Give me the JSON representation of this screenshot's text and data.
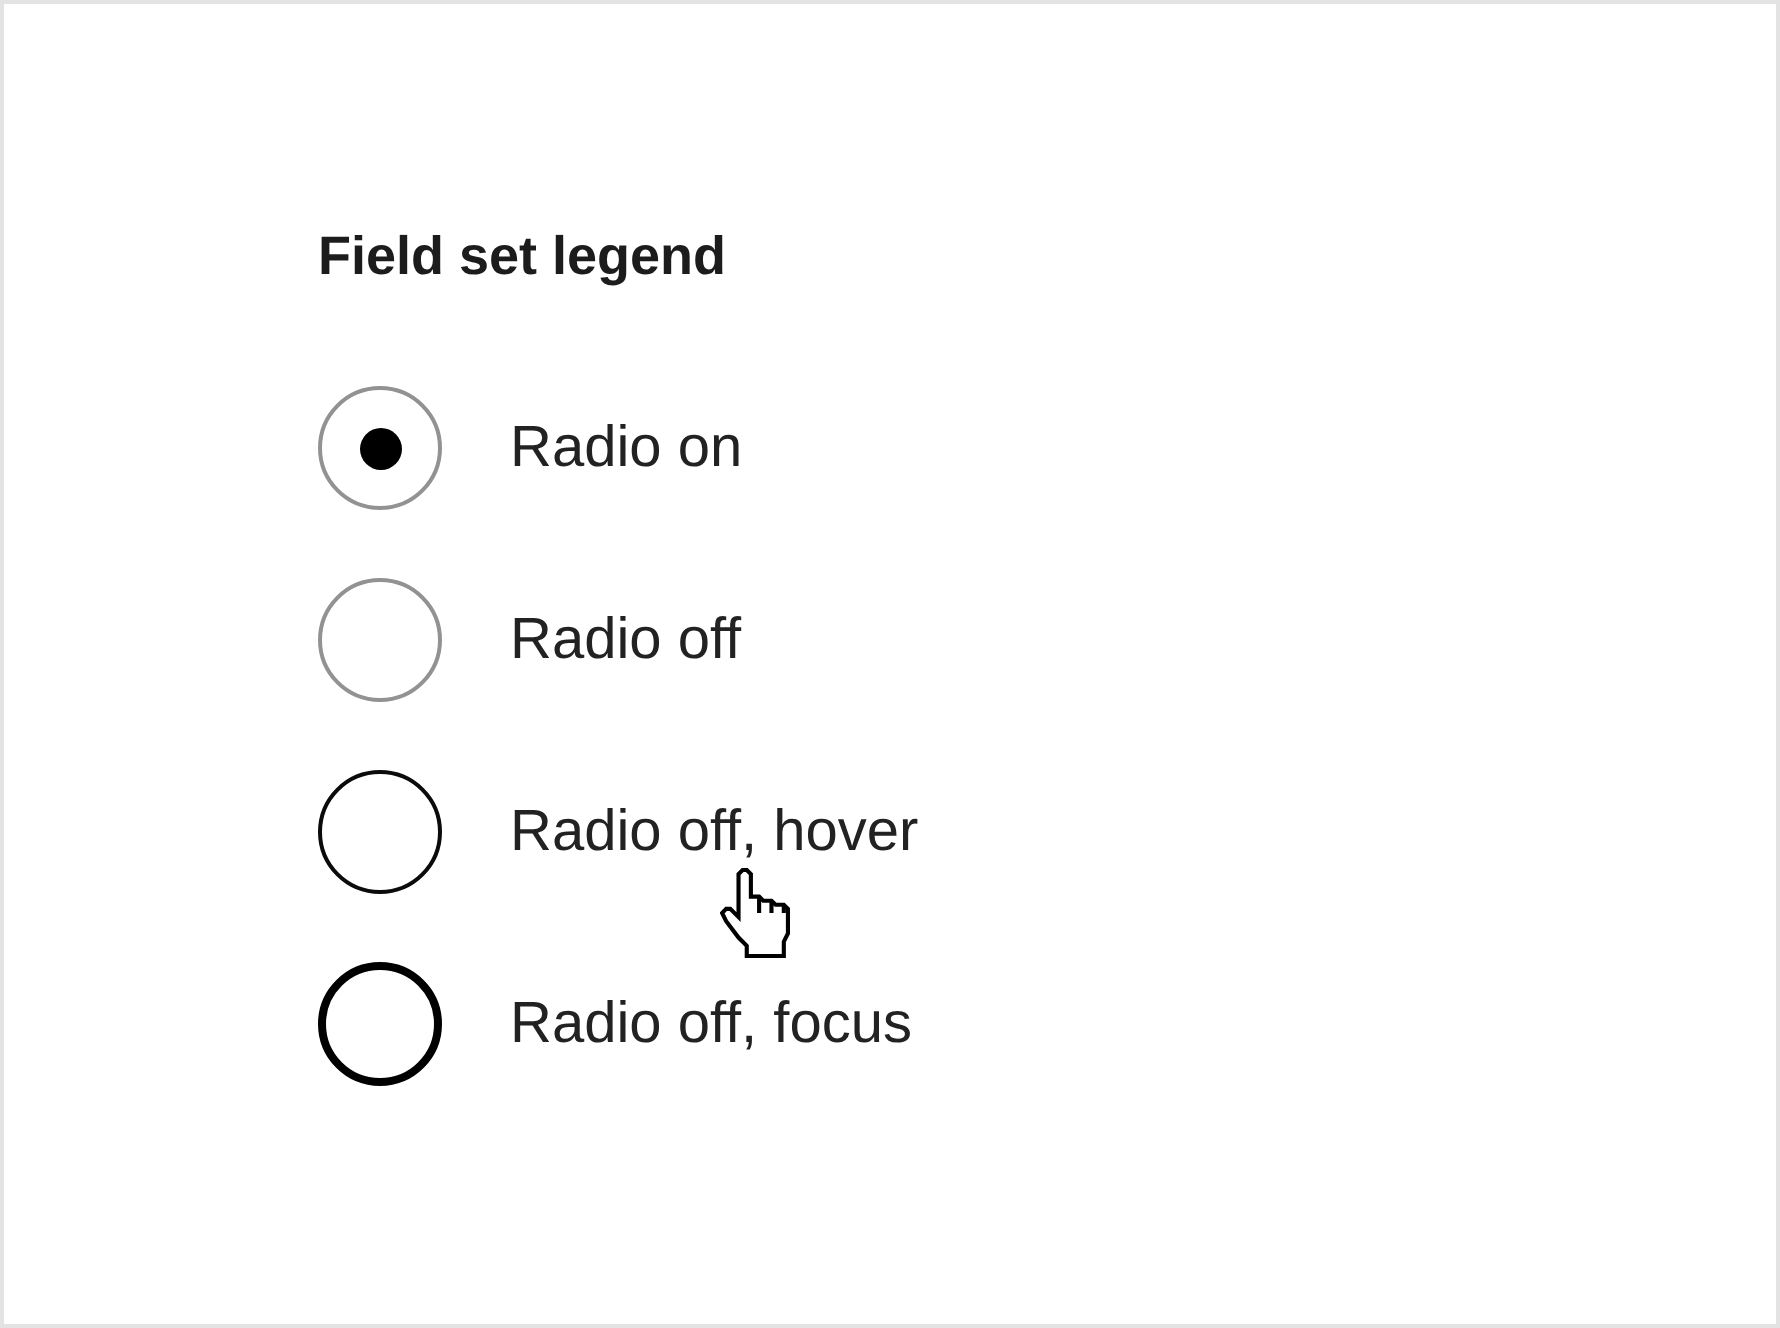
{
  "fieldset": {
    "legend": "Field set legend",
    "options": [
      {
        "label": "Radio on",
        "selected": true,
        "hovered": false,
        "focused": false
      },
      {
        "label": "Radio off",
        "selected": false,
        "hovered": false,
        "focused": false
      },
      {
        "label": "Radio off, hover",
        "selected": false,
        "hovered": true,
        "focused": false
      },
      {
        "label": "Radio off, focus",
        "selected": false,
        "hovered": false,
        "focused": true
      }
    ]
  }
}
